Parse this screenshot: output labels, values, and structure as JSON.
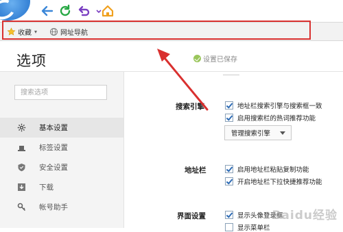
{
  "bookmarks_bar": {
    "favorites_label": "收藏",
    "web_nav_label": "网址导航"
  },
  "page": {
    "title": "选项",
    "save_status": "设置已保存"
  },
  "sidebar": {
    "search_placeholder": "搜索选项",
    "items": [
      {
        "label": "基本设置",
        "icon": "gear-icon",
        "active": true
      },
      {
        "label": "标签设置",
        "icon": "tab-icon",
        "active": false
      },
      {
        "label": "安全设置",
        "icon": "shield-icon",
        "active": false
      },
      {
        "label": "下载",
        "icon": "download-icon",
        "active": false
      },
      {
        "label": "帐号助手",
        "icon": "key-icon",
        "active": false
      }
    ]
  },
  "sections": {
    "search_engine": {
      "label": "搜索引擎",
      "options": [
        {
          "label": "地址栏搜索引擎与搜索框一致",
          "checked": true
        },
        {
          "label": "启用搜索栏的热词推荐功能",
          "checked": true
        }
      ],
      "manage_button": "管理搜索引擎"
    },
    "address_bar": {
      "label": "地址栏",
      "options": [
        {
          "label": "启用地址栏粘贴复制功能",
          "checked": true
        },
        {
          "label": "开启地址栏下拉快捷推荐功能",
          "checked": true
        }
      ]
    },
    "interface": {
      "label": "界面设置",
      "options": [
        {
          "label": "显示头像登录框",
          "checked": true
        },
        {
          "label": "显示菜单栏",
          "checked": false
        }
      ]
    }
  },
  "watermark": "Baidu经验",
  "colors": {
    "highlight": "#d9302f",
    "nav_blue": "#3a86d8",
    "refresh_green": "#27a844",
    "undo_purple": "#7a3fc2",
    "home_orange": "#f0a01e"
  }
}
